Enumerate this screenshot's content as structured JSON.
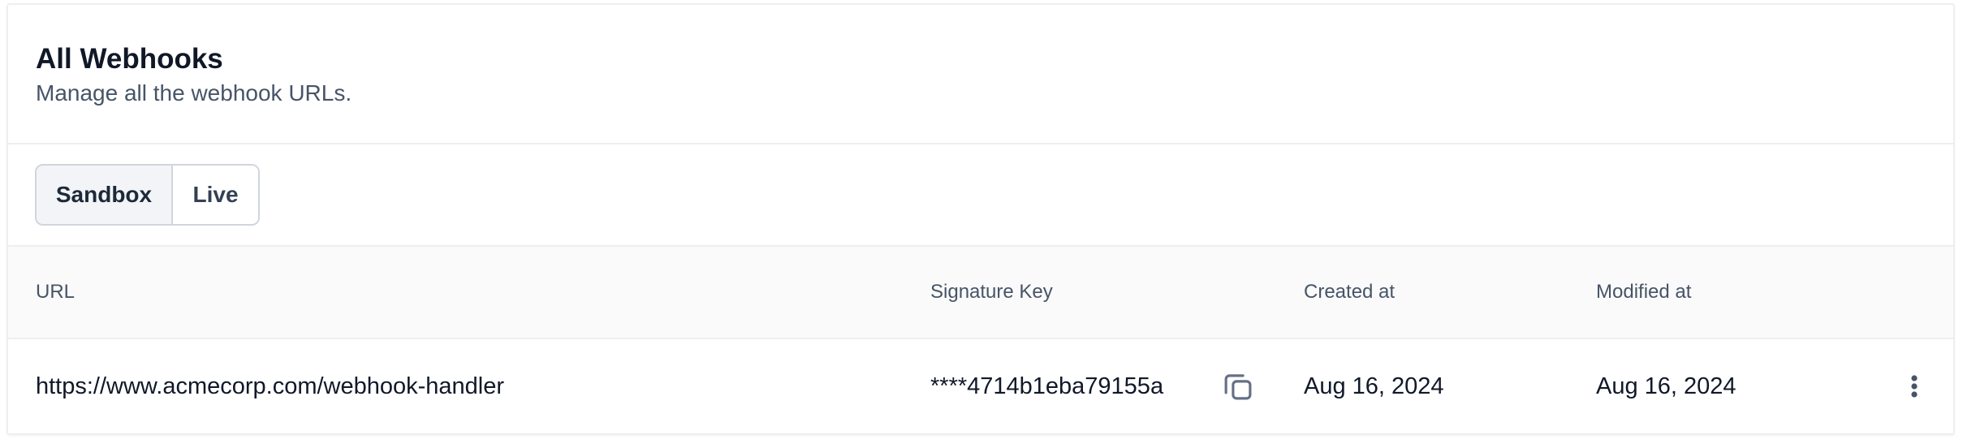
{
  "header": {
    "title": "All Webhooks",
    "subtitle": "Manage all the webhook URLs."
  },
  "tabs": [
    {
      "label": "Sandbox",
      "active": true
    },
    {
      "label": "Live",
      "active": false
    }
  ],
  "table": {
    "columns": [
      "URL",
      "Signature Key",
      "Created at",
      "Modified at"
    ],
    "rows": [
      {
        "url": "https://www.acmecorp.com/webhook-handler",
        "signature_key": "****4714b1eba79155a",
        "created_at": "Aug 16, 2024",
        "modified_at": "Aug 16, 2024",
        "copy_icon": "copy-icon",
        "menu_icon": "more-vertical-icon"
      }
    ]
  },
  "colors": {
    "text_primary": "#101828",
    "text_secondary": "#475467",
    "border": "#eceef1",
    "active_tab_bg": "#f2f4f7",
    "header_bg": "#fafafa"
  }
}
